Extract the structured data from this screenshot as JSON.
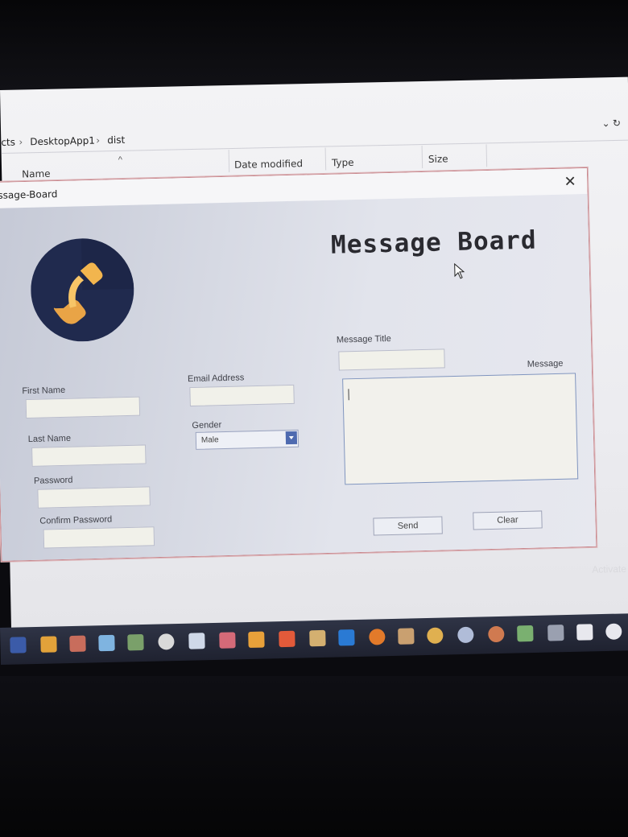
{
  "explorer": {
    "breadcrumb": [
      "cts",
      "DesktopApp1",
      "dist"
    ],
    "columns": [
      "Name",
      "Date modified",
      "Type",
      "Size"
    ],
    "watermark": "Activate W"
  },
  "dialog": {
    "title": "ssage-Board",
    "heading": "Message Board",
    "first_name_label": "First Name",
    "last_name_label": "Last Name",
    "password_label": "Password",
    "confirm_password_label": "Confirm Password",
    "email_label": "Email Address",
    "gender_label": "Gender",
    "gender_value": "Male",
    "message_title_label": "Message Title",
    "message_label": "Message",
    "send_label": "Send",
    "clear_label": "Clear"
  },
  "colors": {
    "logo_bg": "#202a4e",
    "logo_phone": "#f2b54e",
    "dialog_border": "#c7868c"
  },
  "taskbar": {
    "icons": [
      "terminal-icon",
      "box-icon",
      "photos-icon",
      "cube-icon",
      "notes-icon",
      "chrome-icon",
      "cube2-icon",
      "image-icon",
      "sublime-icon",
      "brave-icon",
      "file-icon",
      "vscode-icon",
      "firefox-icon",
      "phone-icon",
      "palette-icon",
      "disk-icon",
      "browser-icon",
      "gallery-icon",
      "calculator-icon",
      "doc-icon",
      "circle-icon"
    ]
  }
}
